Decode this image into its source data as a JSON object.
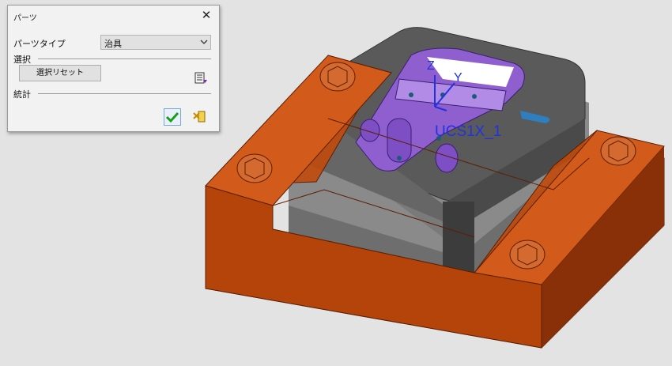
{
  "dialog": {
    "title": "パーツ",
    "parts_type_label": "パーツタイプ",
    "parts_type_value": "治具",
    "selection_section": "選択",
    "reset_selection_button": "選択リセット",
    "statistics_section": "統計"
  },
  "viewport": {
    "ucs_label": "UCS1X_1",
    "axis_z": "Z",
    "axis_y": "Y"
  },
  "icons": {
    "close": "close-icon",
    "dropdown": "chevron-down-icon",
    "selection_options": "list-options-icon",
    "ok": "check-icon",
    "cancel": "cancel-icon"
  },
  "colors": {
    "background": "#e3e3e3",
    "fixture_orange": "#c04a0c",
    "part_gray": "#5a5a5a",
    "highlight_purple": "#8f5fd0",
    "ucs_blue": "#2233dd"
  }
}
